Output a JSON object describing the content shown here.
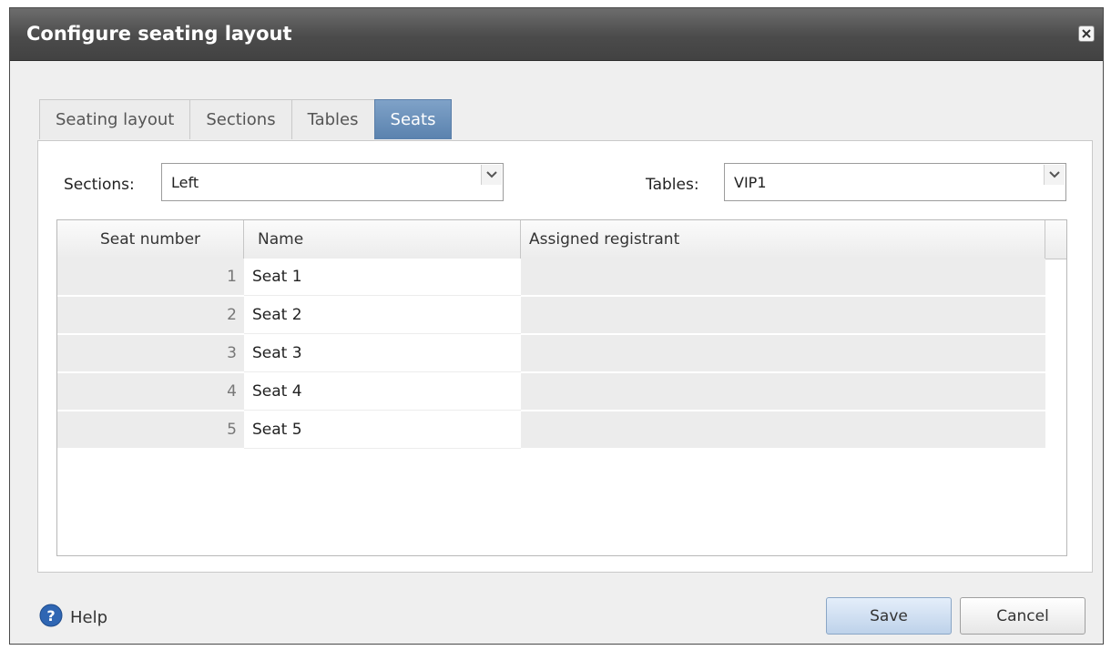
{
  "dialog": {
    "title": "Configure seating layout"
  },
  "tabs": [
    {
      "label": "Seating layout"
    },
    {
      "label": "Sections"
    },
    {
      "label": "Tables"
    },
    {
      "label": "Seats"
    }
  ],
  "filters": {
    "sections_label": "Sections:",
    "sections_value": "Left",
    "tables_label": "Tables:",
    "tables_value": "VIP1"
  },
  "grid": {
    "columns": [
      "Seat number",
      "Name",
      "Assigned registrant"
    ],
    "rows": [
      {
        "seat_number": "1",
        "name": "Seat 1",
        "registrant": ""
      },
      {
        "seat_number": "2",
        "name": "Seat 2",
        "registrant": ""
      },
      {
        "seat_number": "3",
        "name": "Seat 3",
        "registrant": ""
      },
      {
        "seat_number": "4",
        "name": "Seat 4",
        "registrant": ""
      },
      {
        "seat_number": "5",
        "name": "Seat 5",
        "registrant": ""
      }
    ]
  },
  "footer": {
    "help_label": "Help",
    "save_label": "Save",
    "cancel_label": "Cancel"
  },
  "icons": {
    "close": "close-icon",
    "dropdown": "chevron-down-icon",
    "help": "help-circle-icon"
  },
  "colors": {
    "active_tab": "#5a82ae",
    "titlebar": "#4b4b4b"
  }
}
